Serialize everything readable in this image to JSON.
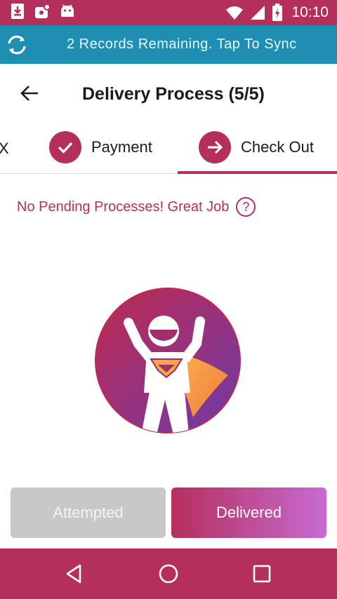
{
  "status_bar": {
    "time": "10:10",
    "left_icons": [
      "download-icon",
      "notification-icon",
      "android-icon"
    ],
    "right_icons": [
      "wifi-icon",
      "signal-icon",
      "battery-icon"
    ]
  },
  "sync_bar": {
    "text": "2 Records Remaining. Tap To Sync",
    "icon": "sync-icon"
  },
  "header": {
    "title": "Delivery Process (5/5)",
    "back_icon": "arrow-left-icon"
  },
  "steps": {
    "partial_label": "X",
    "items": [
      {
        "label": "Payment",
        "icon": "check-icon",
        "state": "done"
      },
      {
        "label": "Check Out",
        "icon": "arrow-right-icon",
        "state": "active"
      }
    ]
  },
  "pending": {
    "message": "No Pending Processes! Great Job",
    "help_glyph": "?"
  },
  "actions": {
    "attempted_label": "Attempted",
    "delivered_label": "Delivered"
  },
  "colors": {
    "primary": "#b52f5c",
    "sync_bar": "#1e8fb2",
    "disabled": "#c8c8c8",
    "gradient_end": "#c76ad2"
  },
  "nav": {
    "icons": [
      "back-triangle-icon",
      "home-circle-icon",
      "recents-square-icon"
    ]
  }
}
